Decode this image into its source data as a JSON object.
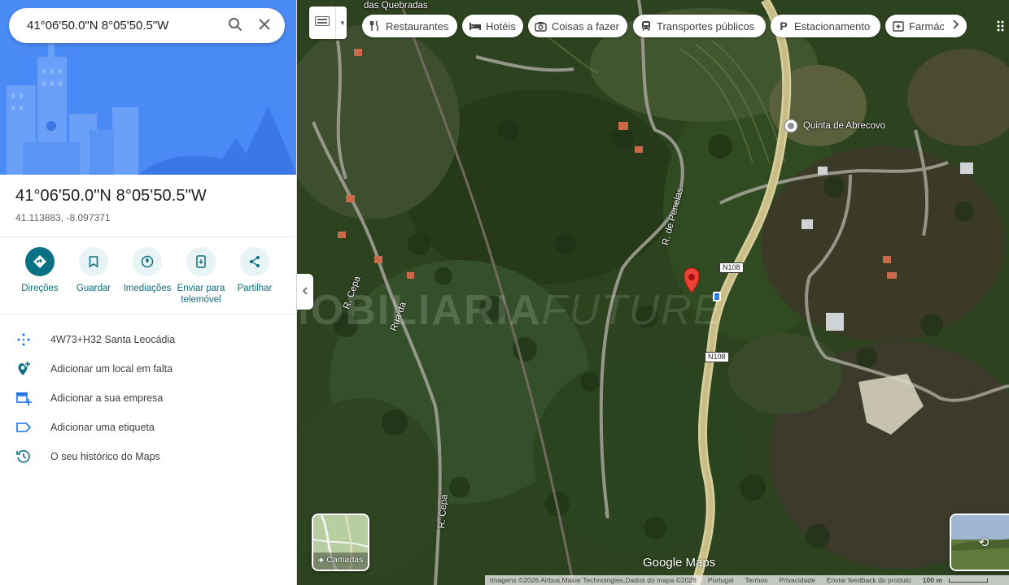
{
  "search": {
    "value": "41°06'50.0\"N 8°05'50.5\"W"
  },
  "place": {
    "title": "41°06'50.0\"N 8°05'50.5\"W",
    "coords": "41.113883, -8.097371"
  },
  "actions": [
    {
      "label": "Direções",
      "icon": "directions-icon"
    },
    {
      "label": "Guardar",
      "icon": "bookmark-icon"
    },
    {
      "label": "Imediações",
      "icon": "nearby-icon"
    },
    {
      "label": "Enviar para telemóvel",
      "icon": "send-to-phone-icon"
    },
    {
      "label": "Partilhar",
      "icon": "share-icon"
    }
  ],
  "list": [
    {
      "label": "4W73+H32 Santa Leocádia",
      "icon": "plus-code-icon"
    },
    {
      "label": "Adicionar um local em falta",
      "icon": "add-place-icon"
    },
    {
      "label": "Adicionar a sua empresa",
      "icon": "add-business-icon"
    },
    {
      "label": "Adicionar uma etiqueta",
      "icon": "label-icon"
    },
    {
      "label": "O seu histórico do Maps",
      "icon": "history-icon"
    }
  ],
  "chips": [
    {
      "label": "Restaurantes",
      "icon": "restaurant-icon"
    },
    {
      "label": "Hotéis",
      "icon": "hotel-icon"
    },
    {
      "label": "Coisas a fazer",
      "icon": "camera-icon"
    },
    {
      "label": "Transportes públicos",
      "icon": "transit-icon"
    },
    {
      "label": "Estacionamento",
      "icon": "parking-icon"
    },
    {
      "label": "Farmác",
      "icon": "pharmacy-icon"
    }
  ],
  "map_labels": {
    "quinta": "Quinta de Abrecovo",
    "top_fragment": "das Quebradas",
    "rua_penelas": "R. de Penelas",
    "rua_cepa_1": "R. Cepa",
    "rua_cepa_2": "R. Cepa",
    "rua_la": "Rua da",
    "n108_a": "N108",
    "n108_b": "N108"
  },
  "watermark": {
    "bold": "IMOBILIARIA",
    "thin": "FUTURE"
  },
  "layers": {
    "label": "Camadas"
  },
  "brand": {
    "logo": "Google Maps"
  },
  "footer": {
    "imagery": "Imagens ©2026 Airbus,Maxar Technologies,Dados do mapa ©2026",
    "country": "Portugal",
    "terms": "Termos",
    "privacy": "Privacidade",
    "feedback": "Enviar feedback do produto",
    "scale": "100 m"
  },
  "colors": {
    "accent": "#0b7285",
    "pin": "#ea4335",
    "hero": "#4285f4"
  }
}
